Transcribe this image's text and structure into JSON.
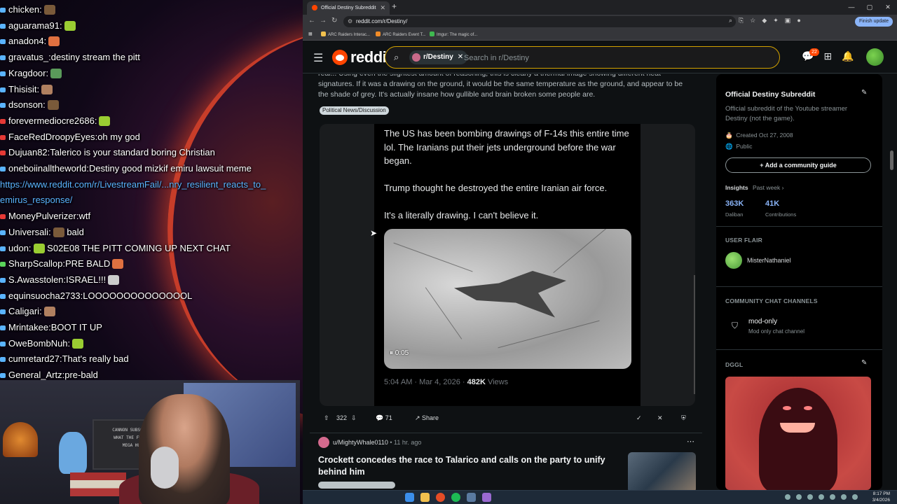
{
  "chat": {
    "messages": [
      {
        "user": "chicken",
        "text": "",
        "color": "#5ab4ff"
      },
      {
        "user": "aguarama91",
        "text": "",
        "color": "#5ab4ff"
      },
      {
        "user": "anadon4",
        "text": "",
        "color": "#5ab4ff"
      },
      {
        "user": "gravatus_",
        "text": "destiny stream the pitt",
        "color": "#5ab4ff"
      },
      {
        "user": "Kragdoor",
        "text": "",
        "color": "#5ab4ff"
      },
      {
        "user": "Thisisit",
        "text": "",
        "color": "#5ab4ff"
      },
      {
        "user": "dsonson",
        "text": "",
        "color": "#5ab4ff"
      },
      {
        "user": "forevermediocre2686",
        "text": "",
        "color": "#e53935"
      },
      {
        "user": "FaceRedDroopyEyes",
        "text": "oh my god",
        "color": "#e53935"
      },
      {
        "user": "Dujuan82",
        "text": "Talerico is your standard boring Christian",
        "color": "#e53935"
      },
      {
        "user": "oneboiinalltheworld",
        "text": "Destiny good mizkif emiru lawsuit meme",
        "color": "#5ab4ff"
      },
      {
        "user": "MoneyPulverizer",
        "text": "wtf",
        "color": "#e53935"
      },
      {
        "user": "Universali",
        "text": "bald",
        "color": "#5ab4ff"
      },
      {
        "user": "udon",
        "text": "S02E08 THE PITT COMING UP NEXT CHAT",
        "color": "#5ab4ff"
      },
      {
        "user": "SharpScallop",
        "text": "PRE BALD",
        "color": "#5ad45a"
      },
      {
        "user": "S.Awasstolen",
        "text": "ISRAEL!!!",
        "color": "#5ab4ff"
      },
      {
        "user": "equinsuocha2733",
        "text": "LOOOOOOOOOOOOOOL",
        "color": "#5ab4ff"
      },
      {
        "user": "Caligari",
        "text": "",
        "color": "#5ab4ff"
      },
      {
        "user": "Mrintakee",
        "text": "BOOT IT UP",
        "color": "#5ab4ff"
      },
      {
        "user": "OweBombNuh",
        "text": "",
        "color": "#5ab4ff"
      },
      {
        "user": "cumretard27",
        "text": "That's really bad",
        "color": "#5ab4ff"
      },
      {
        "user": "General_Artz",
        "text": "pre-bald",
        "color": "#5ab4ff"
      }
    ],
    "link_line1": "https://www.reddit.com/r/LivestreamFail/...nry_resilient_reacts_to_",
    "link_line2": "emirus_response/"
  },
  "webcam": {
    "sign_text": "CANNON SUBSCRIBED\nWHAT THE FUCK IS\nMEGA HURT"
  },
  "browser": {
    "tab_title": "Official Destiny Subreddit",
    "url": "reddit.com/r/Destiny/",
    "finish_update": "Finish update",
    "bookmarks": [
      "ARC Raiders Interac...",
      "ARC Raiders Event T...",
      "Imgur: The magic of..."
    ]
  },
  "reddit": {
    "logo": "reddit",
    "community_chip": "r/Destiny",
    "search_placeholder": "Search in r/Destiny",
    "notification_count": "22",
    "post": {
      "text": "real... Using even the slightest amount of reasoning, this is clearly a thermal image showing different heat signatures. If it was a drawing on the ground, it would be the same temperature as the ground, and appear to be the shade of grey. It's actually insane how gullible and brain broken some people are.",
      "flair": "Political News/Discussion",
      "tweet_p1": "The US has been bombing drawings of F-14s this entire time lol. The Iranians put their jets underground before the war began.",
      "tweet_p2": "Trump thought he destroyed the entire Iranian air force.",
      "tweet_p3": "It's a literally drawing. I can't believe it.",
      "video_time": "0:05",
      "tweet_meta": "5:04 AM · Mar 4, 2026 · ",
      "tweet_views_num": "482K",
      "tweet_views_label": " Views",
      "upvotes": "322",
      "comments": "71",
      "share": "Share"
    },
    "post2": {
      "author": "u/MightyWhale0110",
      "time": "• 11 hr. ago",
      "title": "Crockett concedes the race to Talarico and calls on the party to unify behind him"
    },
    "sidebar": {
      "title": "Official Destiny Subreddit",
      "desc": "Official subreddit of the Youtube streamer Destiny (not the game).",
      "created": "Created Oct 27, 2008",
      "visibility": "Public",
      "guide_btn": "Add a community guide",
      "insights": "Insights",
      "past_week": "Past week",
      "stat1_num": "363K",
      "stat1_label": "Daliban",
      "stat2_num": "41K",
      "stat2_label": "Contributions",
      "user_flair_heading": "USER FLAIR",
      "user_flair_name": "MisterNathaniel",
      "chat_heading": "COMMUNITY CHAT CHANNELS",
      "chat_channel": "mod-only",
      "chat_channel_desc": "Mod only chat channel",
      "dggl_heading": "DGGL"
    }
  },
  "taskbar": {
    "time": "8:17 PM",
    "date": "3/4/2026"
  }
}
